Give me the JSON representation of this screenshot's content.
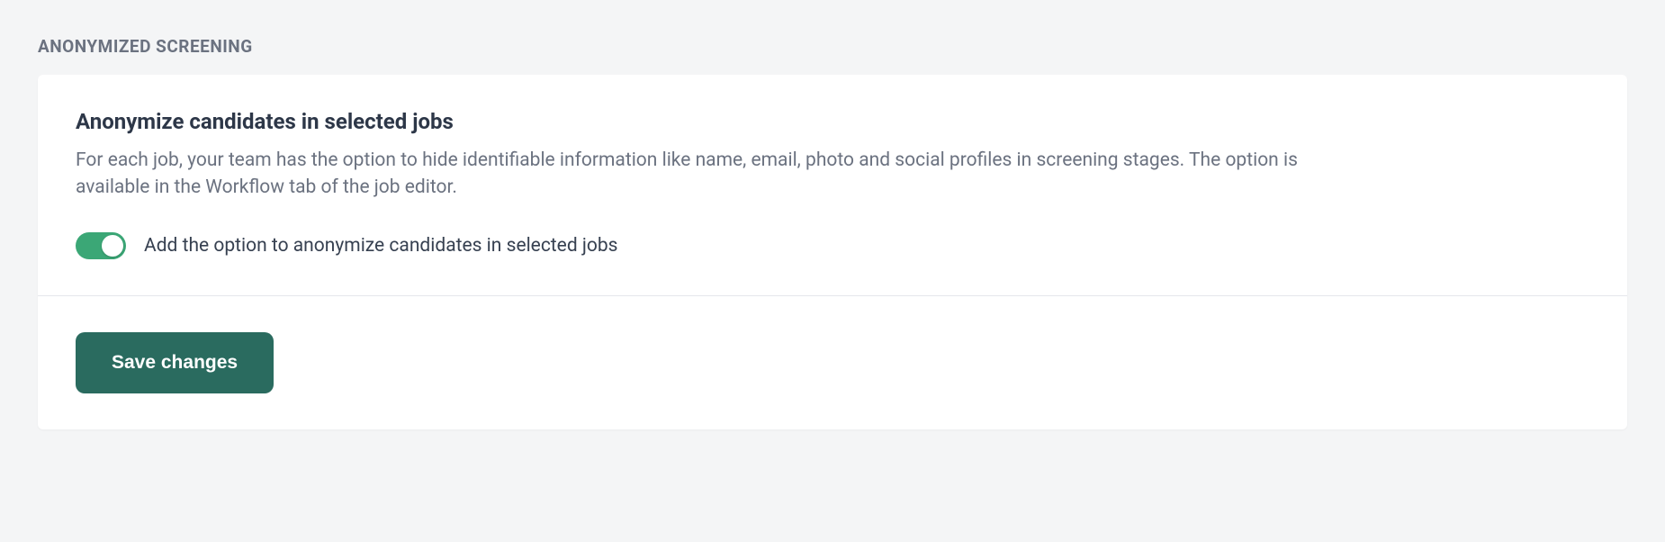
{
  "section": {
    "label": "ANONYMIZED SCREENING"
  },
  "card": {
    "title": "Anonymize candidates in selected jobs",
    "description": "For each job, your team has the option to hide identifiable information like name, email, photo and social profiles in screening stages. The option is available in the Workflow tab of the job editor.",
    "toggle": {
      "label": "Add the option to anonymize candidates in selected jobs",
      "enabled": true
    }
  },
  "actions": {
    "save_label": "Save changes"
  },
  "colors": {
    "toggle_on": "#3ba776",
    "button_primary": "#2a6b5f"
  }
}
